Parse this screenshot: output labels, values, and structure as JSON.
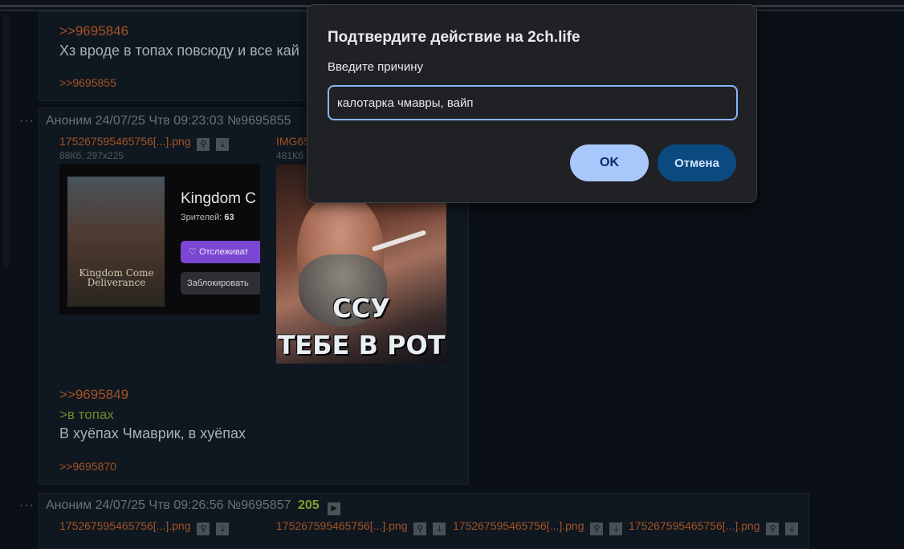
{
  "thread": {
    "post_top": {
      "reply_link": ">>9695846",
      "text": "Хз вроде в топах повсюду и все кай",
      "backlink": ">>9695855"
    },
    "post_mid": {
      "header": {
        "dots": "···",
        "author": "Аноним",
        "datetime": "24/07/25 Чтв 09:23:03",
        "number": "№9695855"
      },
      "file1": {
        "name": "175267595465756[...].png",
        "meta": "88Кб, 297x225",
        "search_icon": "search-icon",
        "download_icon": "download-icon"
      },
      "file2": {
        "name": "IMG65",
        "meta": "481Кб"
      },
      "thumb1": {
        "cover_title": "Kingdom Come Deliverance",
        "stream_title": "Kingdom C",
        "viewers_label": "Зрителей:",
        "viewers_count": "63",
        "follow": "Отслеживат",
        "block": "Заблокировать"
      },
      "thumb2": {
        "line1": "ССУ",
        "line2": "ТЕБЕ В РОТ"
      },
      "reply_link": ">>9695849",
      "greentext": ">в топах",
      "text": "В хуёпах Чмаврик, в хуёпах",
      "backlink": ">>9695870"
    },
    "post_bottom": {
      "header": {
        "dots": "···",
        "author": "Аноним",
        "datetime": "24/07/25 Чтв 09:26:56",
        "number": "№9695857",
        "count": "205"
      },
      "files": [
        "175267595465756[...].png",
        "175267595465756[...].png",
        "175267595465756[...].png",
        "175267595465756[...].png"
      ]
    }
  },
  "dialog": {
    "title": "Подтвердите действие на 2ch.life",
    "prompt": "Введите причину",
    "input_value": "калотарка чмавры, вайп",
    "ok_label": "OK",
    "cancel_label": "Отмена"
  },
  "colors": {
    "link": "#a55324",
    "greentext": "#6c8b2a",
    "accent": "#8ab4f8",
    "ok_bg": "#a8c7fa",
    "cancel_bg": "#0b4a80"
  }
}
